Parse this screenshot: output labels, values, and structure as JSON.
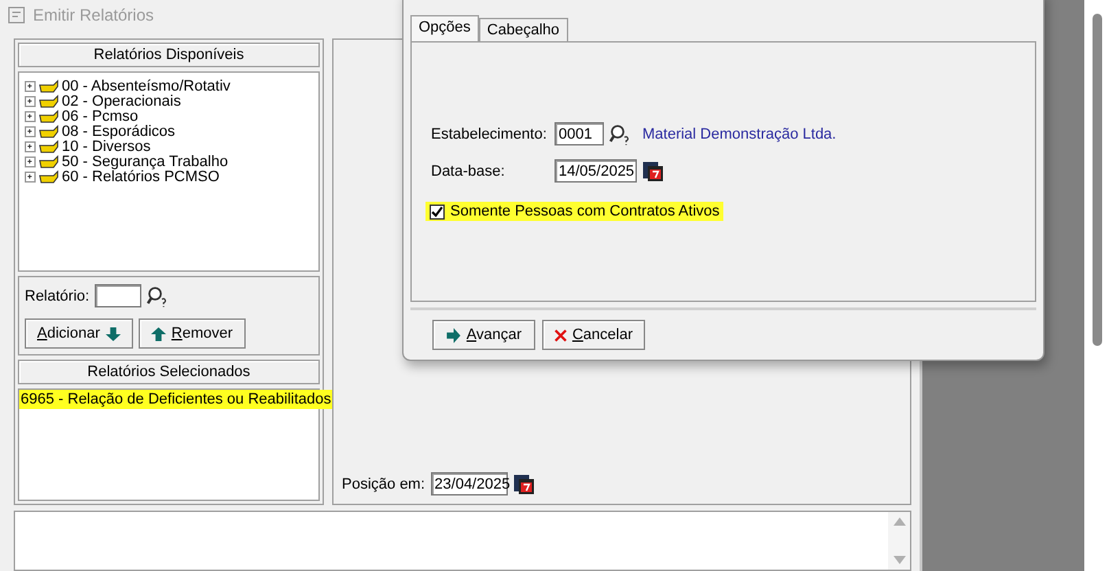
{
  "window": {
    "title": "Emitir Relatórios"
  },
  "available_panel": {
    "header": "Relatórios Disponíveis",
    "tree": [
      {
        "label": "00 - Absenteísmo/Rotativ",
        "expanded": false
      },
      {
        "label": "02 - Operacionais",
        "expanded": false
      },
      {
        "label": "06 - Pcmso",
        "expanded": false
      },
      {
        "label": "08 - Esporádicos",
        "expanded": false
      },
      {
        "label": "10 - Diversos",
        "expanded": false
      },
      {
        "label": "50 - Segurança Trabalho",
        "expanded": false
      },
      {
        "label": "60 - Relatórios PCMSO",
        "expanded": false
      }
    ]
  },
  "report_field": {
    "label": "Relatório:"
  },
  "report_buttons": [
    {
      "label": "Adicionar",
      "kind": "add"
    },
    {
      "label": "Remover",
      "kind": "remove"
    }
  ],
  "selected_panel": {
    "header": "Relatórios Selecionados",
    "items": [
      {
        "label": "6965 - Relação de Deficientes ou Reabilitados",
        "selected": true
      }
    ]
  },
  "position": {
    "label": "Posição em:",
    "value": "23/04/2025"
  },
  "dialog": {
    "tabs": [
      {
        "label": "Opções",
        "selected": true
      },
      {
        "label": "Cabeçalho",
        "selected": false
      }
    ],
    "establishment": {
      "label": "Estabelecimento:",
      "value": "0001",
      "name": "Material Demonstração Ltda."
    },
    "base_date": {
      "label": "Data-base:",
      "value": "14/05/2025"
    },
    "active_contracts": {
      "label": "Somente Pessoas com Contratos Ativos",
      "checked": true,
      "highlighted": true
    },
    "buttons": [
      {
        "label": "Avançar",
        "kind": "next"
      },
      {
        "label": "Cancelar",
        "kind": "cancel"
      }
    ]
  }
}
